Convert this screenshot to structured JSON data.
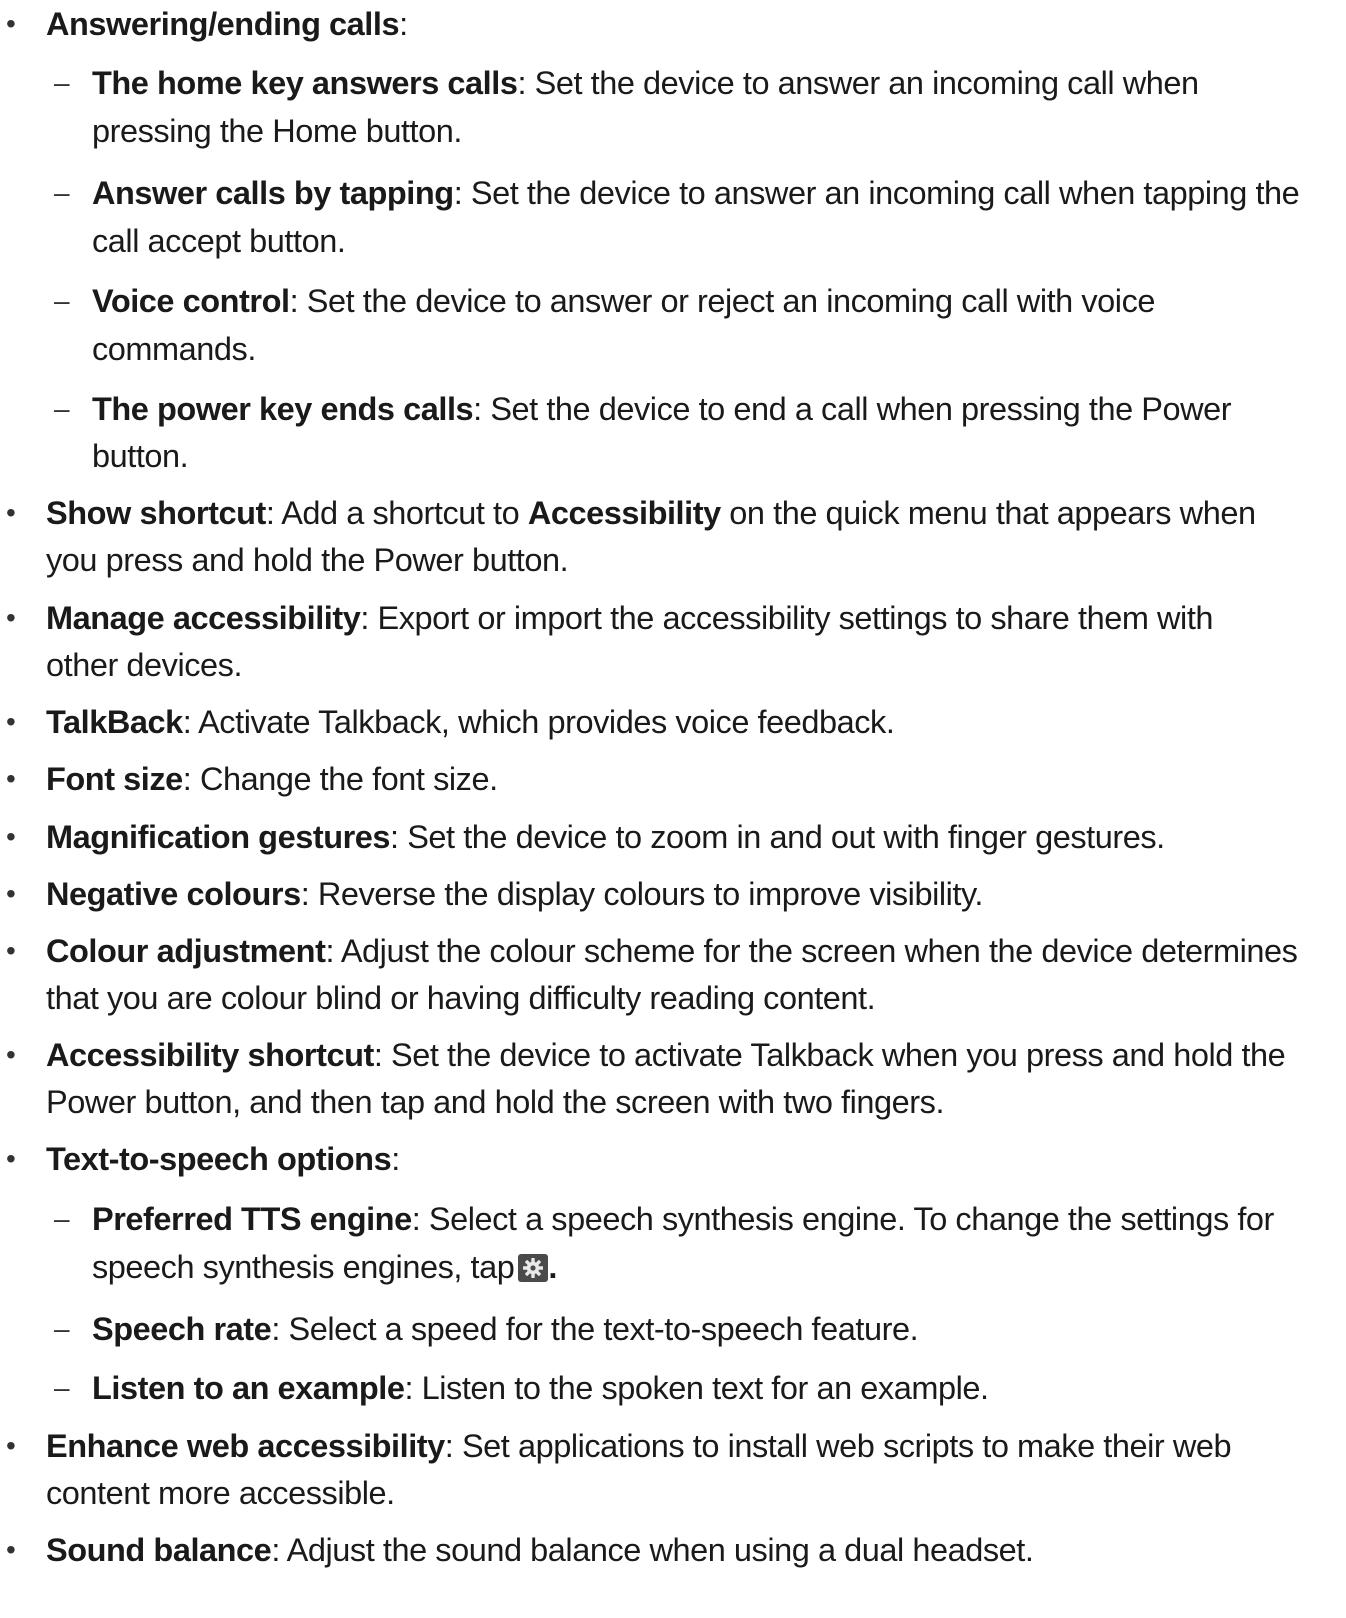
{
  "items": [
    {
      "level": 1,
      "term": "Answering/ending calls",
      "desc": ":"
    },
    {
      "level": 2,
      "term": "The home key answers calls",
      "desc": ": Set the device to answer an incoming call when",
      "cont": "pressing the Home button."
    },
    {
      "level": 2,
      "term": "Answer calls by tapping",
      "desc": ": Set the device to answer an incoming call when tapping the",
      "cont": "call accept button."
    },
    {
      "level": 2,
      "term": "Voice control",
      "desc": ": Set the device to answer or reject an incoming call with voice",
      "cont": "commands."
    },
    {
      "level": 2,
      "term": "The power key ends calls",
      "desc": ": Set the device to end a call when pressing the Power",
      "cont": "button."
    },
    {
      "level": 1,
      "term": "Show shortcut",
      "desc_a": ": Add a shortcut to ",
      "term2": "Accessibility",
      "desc_b": " on the quick menu that appears when",
      "cont": "you press and hold the Power button."
    },
    {
      "level": 1,
      "term": "Manage accessibility",
      "desc": ": Export or import the accessibility settings to share them with",
      "cont": "other devices."
    },
    {
      "level": 1,
      "term": "TalkBack",
      "desc": ": Activate Talkback, which provides voice feedback."
    },
    {
      "level": 1,
      "term": "Font size",
      "desc": ": Change the font size."
    },
    {
      "level": 1,
      "term": "Magnification gestures",
      "desc": ": Set the device to zoom in and out with finger gestures."
    },
    {
      "level": 1,
      "term": "Negative colours",
      "desc": ": Reverse the display colours to improve visibility."
    },
    {
      "level": 1,
      "term": "Colour adjustment",
      "desc": ": Adjust the colour scheme for the screen when the device determines",
      "cont": "that you are colour blind or having difficulty reading content."
    },
    {
      "level": 1,
      "term": "Accessibility shortcut",
      "desc": ": Set the device to activate Talkback when you press and hold the",
      "cont": "Power button, and then tap and hold the screen with two fingers."
    },
    {
      "level": 1,
      "term": "Text-to-speech options",
      "desc": ":"
    },
    {
      "level": 2,
      "term": "Preferred TTS engine",
      "desc": ": Select a speech synthesis engine. To change the settings for",
      "cont": "speech synthesis engines, tap",
      "icon": "gear-icon",
      "cont_end": "."
    },
    {
      "level": 2,
      "term": "Speech rate",
      "desc": ": Select a speed for the text-to-speech feature."
    },
    {
      "level": 2,
      "term": "Listen to an example",
      "desc": ": Listen to the spoken text for an example."
    },
    {
      "level": 1,
      "term": "Enhance web accessibility",
      "desc": ": Set applications to install web scripts to make their web",
      "cont": "content more accessible."
    },
    {
      "level": 1,
      "term": "Sound balance",
      "desc": ": Adjust the sound balance when using a dual headset."
    }
  ],
  "markers": {
    "bullet": "•",
    "dash": "–"
  }
}
